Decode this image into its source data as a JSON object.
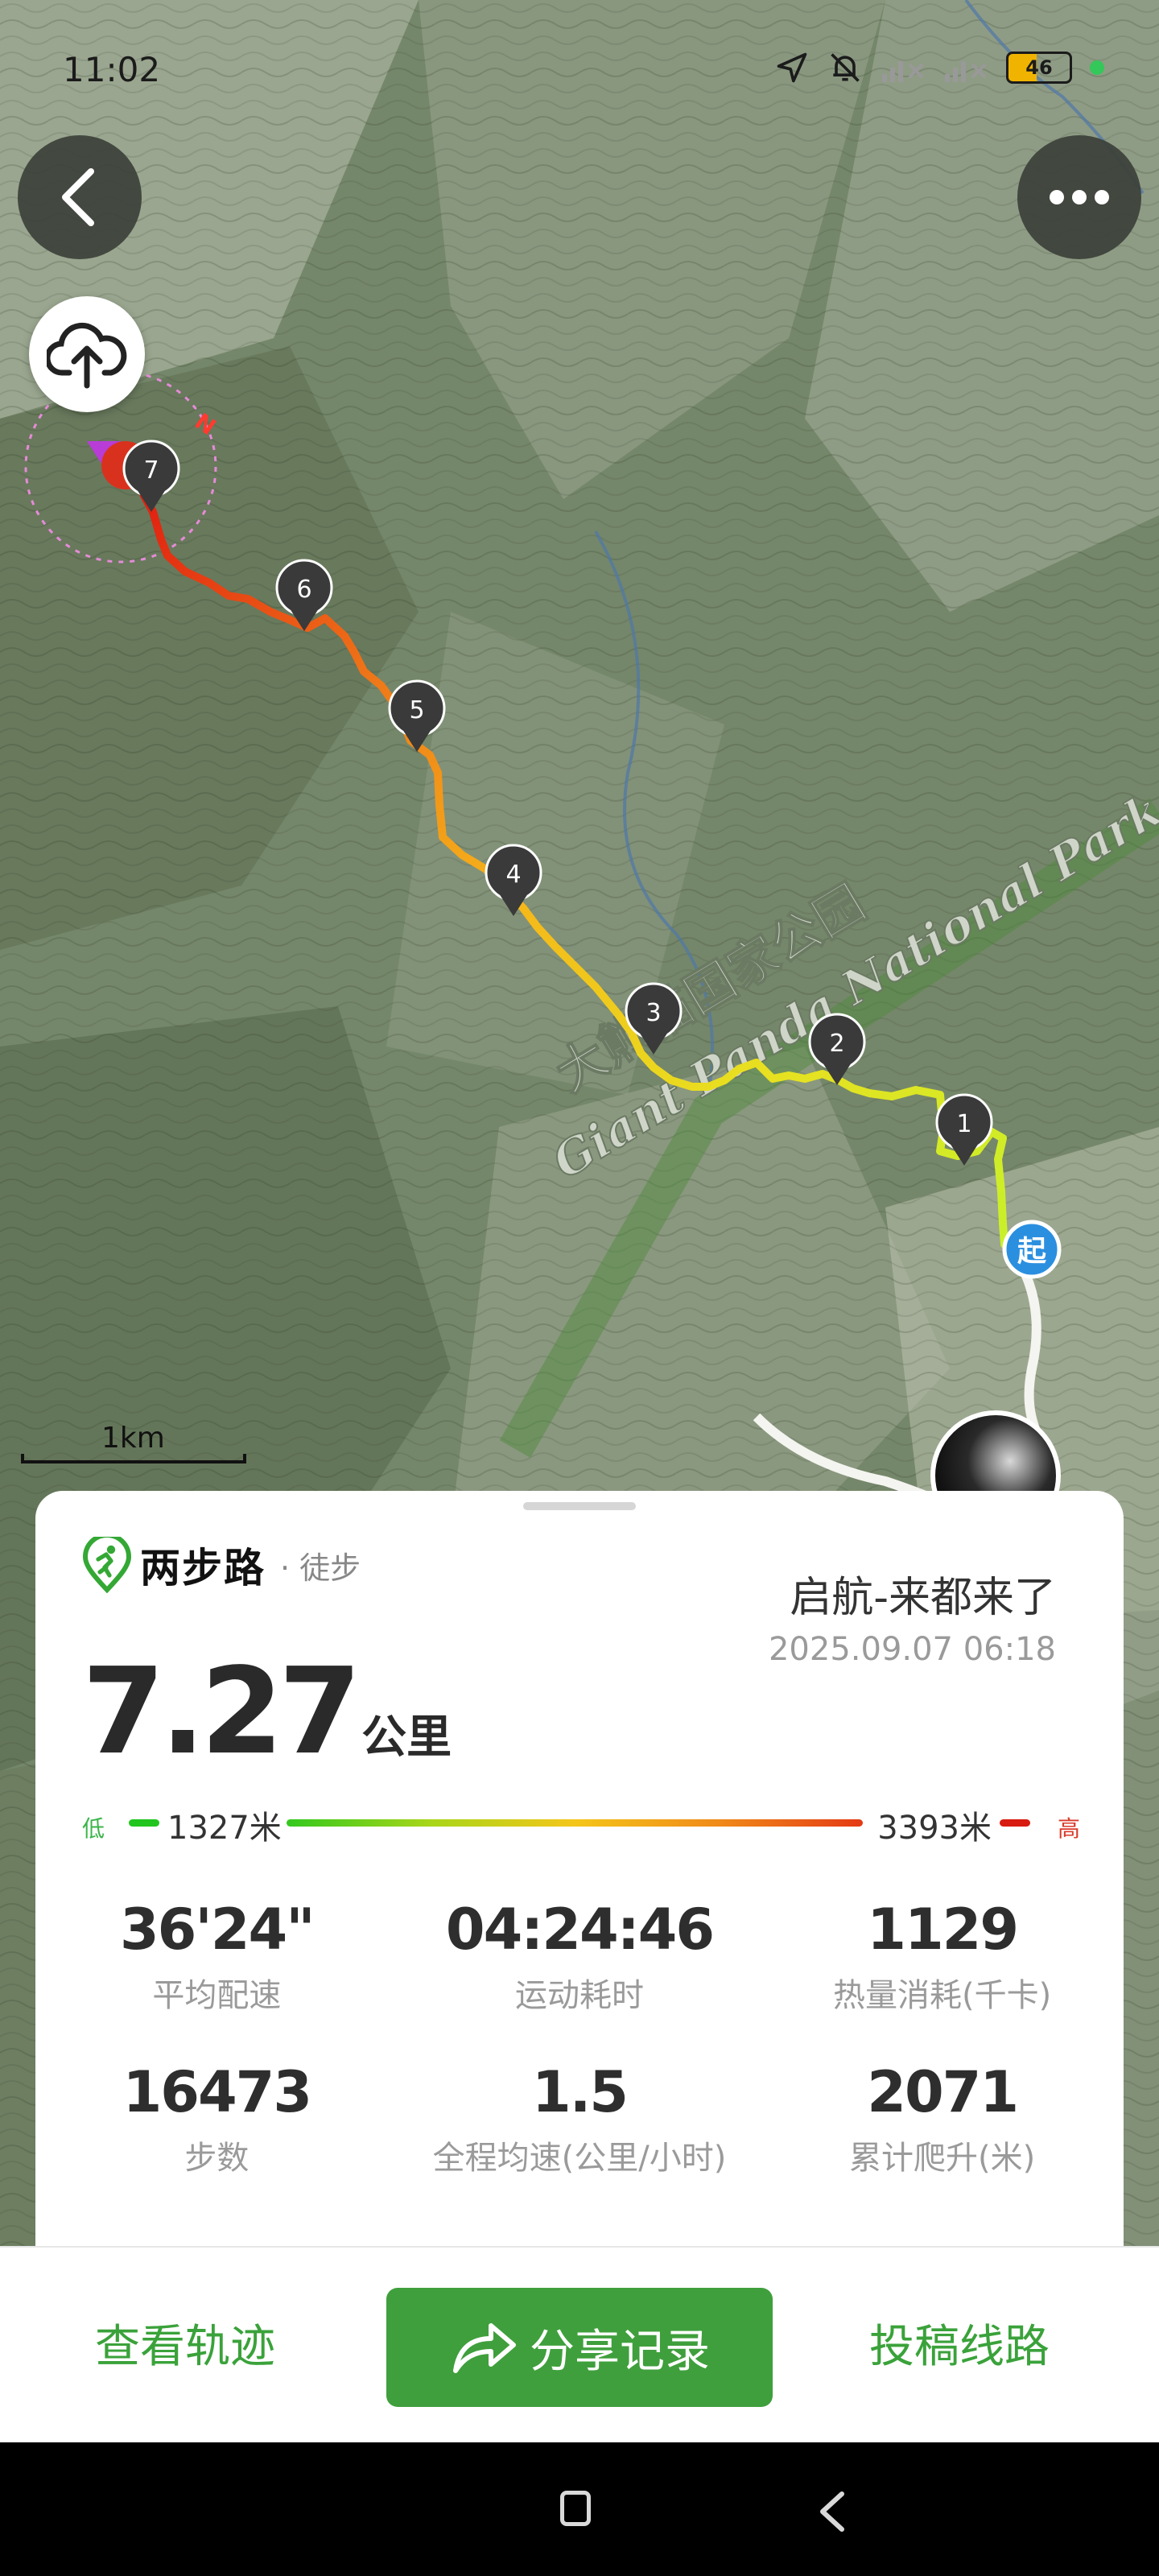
{
  "status_bar": {
    "time": "11:02",
    "battery": "46"
  },
  "map": {
    "park_label_cn": "大熊猫国家公园",
    "park_label_en": "Giant Panda National Park",
    "start_marker": "起",
    "compass": "N",
    "waypoints": [
      "1",
      "2",
      "3",
      "4",
      "5",
      "6",
      "7"
    ],
    "scale_label": "1km",
    "icons": [
      "back-arrow-icon",
      "more-icon",
      "cloud-upload-icon"
    ]
  },
  "card": {
    "brand_name": "两步路",
    "brand_type": "· 徒步",
    "title": "启航-来都来了",
    "date": "2025.09.07 06:18",
    "distance": "7.27",
    "distance_unit": "公里",
    "elevation": {
      "low_tag": "低",
      "high_tag": "高",
      "min": "1327米",
      "max": "3393米"
    },
    "stats": [
      {
        "value": "36'24\"",
        "label": "平均配速"
      },
      {
        "value": "04:24:46",
        "label": "运动耗时"
      },
      {
        "value": "1129",
        "label": "热量消耗(千卡)"
      },
      {
        "value": "16473",
        "label": "步数"
      },
      {
        "value": "1.5",
        "label": "全程均速(公里/小时)"
      },
      {
        "value": "2071",
        "label": "累计爬升(米)"
      }
    ]
  },
  "actions": {
    "view_track": "查看轨迹",
    "share": "分享记录",
    "submit": "投稿线路"
  },
  "colors": {
    "brand_green": "#3f9f3c",
    "text_green": "#3aa23a"
  }
}
